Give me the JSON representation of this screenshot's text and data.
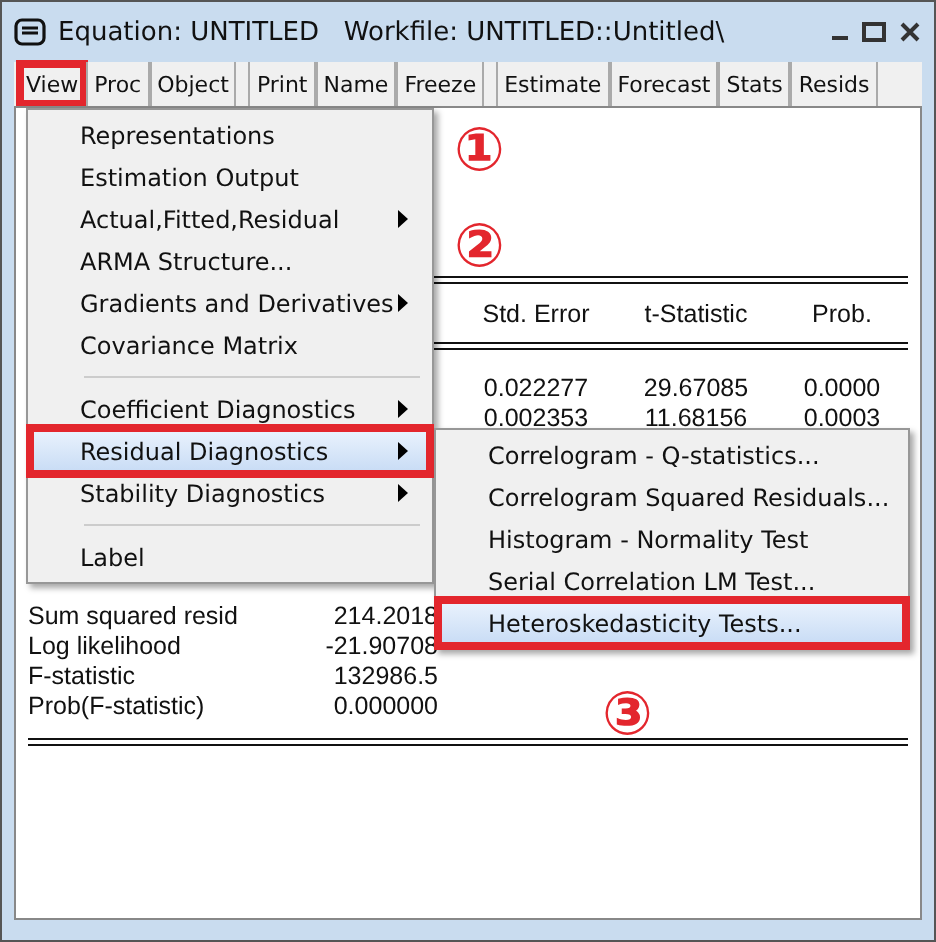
{
  "window": {
    "title": "Equation: UNTITLED   Workfile: UNTITLED::Untitled\\"
  },
  "toolbar": [
    {
      "label": "View",
      "marked": true,
      "gap_before": false
    },
    {
      "label": "Proc",
      "marked": false,
      "gap_before": false
    },
    {
      "label": "Object",
      "marked": false,
      "gap_before": false
    },
    {
      "label": "Print",
      "marked": false,
      "gap_before": true
    },
    {
      "label": "Name",
      "marked": false,
      "gap_before": false
    },
    {
      "label": "Freeze",
      "marked": false,
      "gap_before": false
    },
    {
      "label": "Estimate",
      "marked": false,
      "gap_before": true
    },
    {
      "label": "Forecast",
      "marked": false,
      "gap_before": false
    },
    {
      "label": "Stats",
      "marked": false,
      "gap_before": false
    },
    {
      "label": "Resids",
      "marked": false,
      "gap_before": false
    }
  ],
  "table": {
    "columns": [
      "Std. Error",
      "t-Statistic",
      "Prob."
    ],
    "rows": [
      [
        "0.022277",
        "29.67085",
        "0.0000"
      ],
      [
        "0.002353",
        "11.68156",
        "0.0003"
      ]
    ]
  },
  "stats": [
    [
      "Sum squared resid",
      "214.2018"
    ],
    [
      "Log likelihood",
      "-21.90708"
    ],
    [
      "F-statistic",
      "132986.5"
    ],
    [
      "Prob(F-statistic)",
      "0.000000"
    ]
  ],
  "view_menu": [
    {
      "kind": "item",
      "label": "Representations",
      "submenu": false,
      "selected": false,
      "marked": false
    },
    {
      "kind": "item",
      "label": "Estimation Output",
      "submenu": false,
      "selected": false,
      "marked": false
    },
    {
      "kind": "item",
      "label": "Actual,Fitted,Residual",
      "submenu": true,
      "selected": false,
      "marked": false
    },
    {
      "kind": "item",
      "label": "ARMA Structure...",
      "submenu": false,
      "selected": false,
      "marked": false
    },
    {
      "kind": "item",
      "label": "Gradients and Derivatives",
      "submenu": true,
      "selected": false,
      "marked": false
    },
    {
      "kind": "item",
      "label": "Covariance Matrix",
      "submenu": false,
      "selected": false,
      "marked": false
    },
    {
      "kind": "separator"
    },
    {
      "kind": "item",
      "label": "Coefficient Diagnostics",
      "submenu": true,
      "selected": false,
      "marked": false
    },
    {
      "kind": "item",
      "label": "Residual Diagnostics",
      "submenu": true,
      "selected": true,
      "marked": true
    },
    {
      "kind": "item",
      "label": "Stability Diagnostics",
      "submenu": true,
      "selected": false,
      "marked": false
    },
    {
      "kind": "separator"
    },
    {
      "kind": "item",
      "label": "Label",
      "submenu": false,
      "selected": false,
      "marked": false
    }
  ],
  "residual_submenu": [
    {
      "kind": "item",
      "label": "Correlogram - Q-statistics...",
      "selected": false,
      "marked": false
    },
    {
      "kind": "item",
      "label": "Correlogram Squared Residuals...",
      "selected": false,
      "marked": false
    },
    {
      "kind": "item",
      "label": "Histogram - Normality Test",
      "selected": false,
      "marked": false
    },
    {
      "kind": "item",
      "label": "Serial Correlation LM Test...",
      "selected": false,
      "marked": false
    },
    {
      "kind": "item",
      "label": "Heteroskedasticity Tests...",
      "selected": true,
      "marked": true
    }
  ],
  "annotations": [
    "①",
    "②",
    "③"
  ]
}
